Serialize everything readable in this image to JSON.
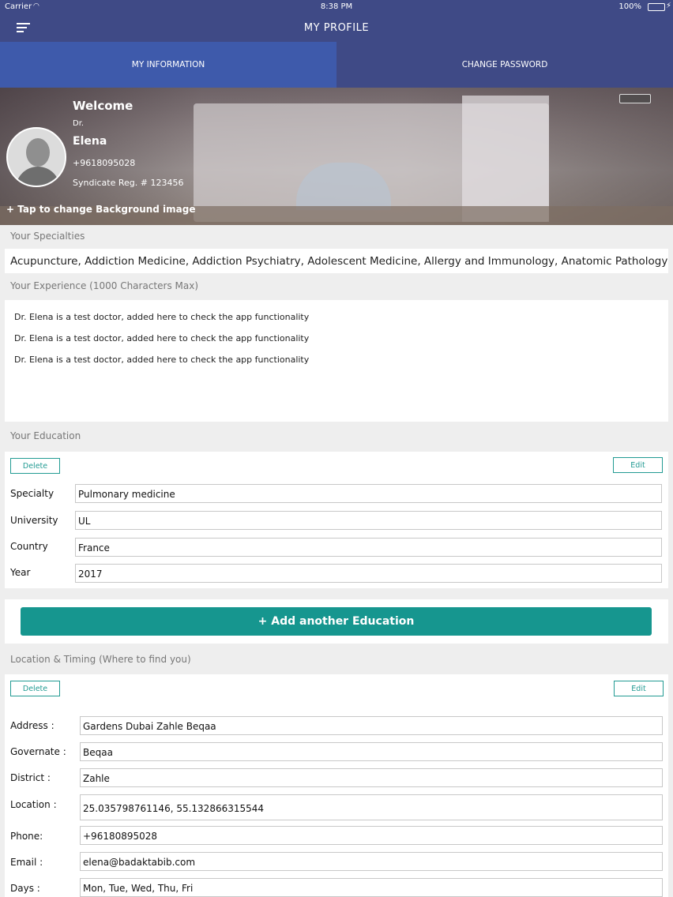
{
  "status": {
    "carrier": "Carrier",
    "time": "8:38 PM",
    "battery": "100%"
  },
  "nav": {
    "title": "MY PROFILE"
  },
  "tabs": [
    {
      "label": "MY INFORMATION"
    },
    {
      "label": "CHANGE PASSWORD"
    }
  ],
  "profile": {
    "welcome": "Welcome",
    "title": "Dr.",
    "name": "Elena",
    "phone": "+9618095028",
    "registration": "Syndicate Reg. # 123456",
    "change_bg": "+ Tap to change Background image"
  },
  "specialties": {
    "label": "Your Specialties",
    "value": "Acupuncture, Addiction Medicine, Addiction Psychiatry, Adolescent Medicine, Allergy and Immunology, Anatomic Pathology"
  },
  "experience": {
    "label": "Your Experience (1000 Characters Max)",
    "lines": [
      "Dr. Elena is a test doctor, added here to check the app functionality",
      "Dr. Elena is a test doctor, added here to check the app functionality",
      "Dr. Elena is a test doctor, added here to check the app functionality"
    ]
  },
  "education": {
    "label": "Your Education",
    "delete_label": "Delete",
    "edit_label": "Edit",
    "fields": [
      {
        "label": "Specialty",
        "value": "Pulmonary medicine"
      },
      {
        "label": "University",
        "value": "UL"
      },
      {
        "label": "Country",
        "value": "France"
      },
      {
        "label": "Year",
        "value": "2017"
      }
    ],
    "add_label": "+ Add another Education"
  },
  "location": {
    "label": "Location & Timing (Where to find you)",
    "delete_label": "Delete",
    "edit_label": "Edit",
    "fields": [
      {
        "label": "Address :",
        "value": "Gardens Dubai Zahle Beqaa"
      },
      {
        "label": "Governate :",
        "value": "Beqaa"
      },
      {
        "label": "District :",
        "value": "Zahle"
      },
      {
        "label": "Location :",
        "value": "25.035798761146, 55.132866315544"
      },
      {
        "label": "Phone:",
        "value": "+96180895028"
      },
      {
        "label": "Email :",
        "value": "elena@badaktabib.com"
      },
      {
        "label": "Days :",
        "value": "Mon, Tue, Wed, Thu, Fri"
      }
    ]
  },
  "colors": {
    "nav_bg": "#3f4a86",
    "active_tab": "#3e5aab",
    "accent_teal": "#16968f"
  }
}
